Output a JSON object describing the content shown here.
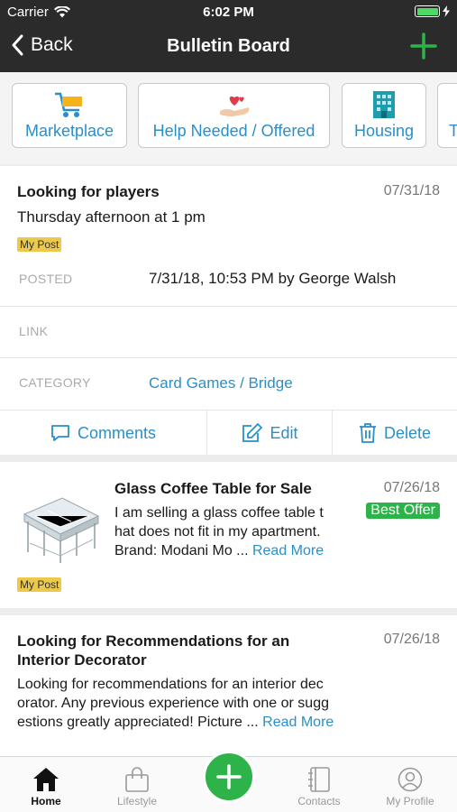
{
  "status": {
    "carrier": "Carrier",
    "time": "6:02 PM"
  },
  "nav": {
    "back_label": "Back",
    "title": "Bulletin Board"
  },
  "categories": [
    {
      "label": "Marketplace",
      "icon": "cart-icon"
    },
    {
      "label": "Help Needed / Offered",
      "icon": "helping-hand-icon"
    },
    {
      "label": "Housing",
      "icon": "building-icon"
    },
    {
      "label": "T",
      "icon": ""
    }
  ],
  "posts": [
    {
      "title": "Looking for players",
      "date": "07/31/18",
      "body": "Thursday afternoon at 1 pm",
      "badge": "My Post",
      "posted_label": "POSTED",
      "posted_value": "7/31/18, 10:53 PM by George Walsh",
      "link_label": "LINK",
      "category_label": "CATEGORY",
      "category_value": "Card Games / Bridge",
      "actions": {
        "comments": "Comments",
        "edit": "Edit",
        "delete": "Delete"
      }
    },
    {
      "title": "Glass Coffee Table for Sale",
      "date": "07/26/18",
      "tag": "Best Offer",
      "body_lines": [
        "I am selling a glass coffee table t",
        "hat does not fit in my apartment.",
        "Brand: Modani Mo ..."
      ],
      "read_more": "Read More",
      "badge": "My Post"
    },
    {
      "title_lines": [
        "Looking for Recommendations for an",
        "Interior Decorator"
      ],
      "date": "07/26/18",
      "body_lines": [
        "Looking for recommendations for an interior dec",
        "orator. Any previous experience with one or sugg",
        "estions greatly appreciated! Picture ..."
      ],
      "read_more": "Read More"
    }
  ],
  "tabs": [
    {
      "label": "Home",
      "icon": "home-icon",
      "active": true
    },
    {
      "label": "Lifestyle",
      "icon": "shopping-bag-icon"
    },
    {
      "label": "Contacts",
      "icon": "contacts-book-icon"
    },
    {
      "label": "My Profile",
      "icon": "profile-icon"
    }
  ],
  "colors": {
    "accent_blue": "#2a8fc8",
    "green": "#2eb34a",
    "dark_bar": "#2b2b2b",
    "badge_yellow": "#ecc94b"
  }
}
